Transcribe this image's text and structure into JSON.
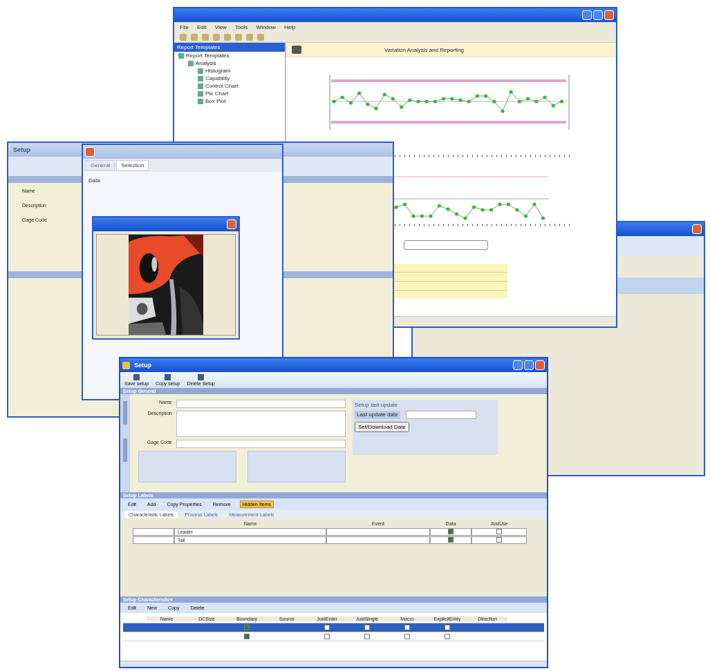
{
  "chart_window": {
    "menu": [
      "File",
      "Edit",
      "View",
      "Tools",
      "Window",
      "Help"
    ],
    "tree_title": "Report Templates",
    "tree": [
      {
        "label": "Report Templates",
        "children": [
          {
            "label": "Analysis",
            "children": [
              {
                "label": "Histogram"
              },
              {
                "label": "Capability"
              },
              {
                "label": "Control Chart"
              },
              {
                "label": "Pie Chart"
              },
              {
                "label": "Box Plot"
              }
            ]
          }
        ]
      }
    ],
    "header": "Variation Analysis and Reporting"
  },
  "back_setup": {
    "title": "Setup",
    "labels": [
      "Name",
      "Description",
      "Gage Code"
    ]
  },
  "editor_window": {
    "tabs": [
      {
        "label": "General",
        "selected": false
      },
      {
        "label": "Selection",
        "selected": true
      }
    ],
    "field_label": "Data"
  },
  "setup_window": {
    "title": "Setup",
    "toolbar": [
      "Save setup",
      "Copy setup",
      "Delete Setup"
    ],
    "general": {
      "title": "Setup General",
      "fields": [
        "Name",
        "Description",
        "Gage Code"
      ],
      "update_group": "Setup last update",
      "update_label": "Last update date",
      "update_button": "Set/Download Date"
    },
    "labels": {
      "title": "Setup Labels",
      "toolbar": [
        {
          "label": "Edit",
          "on": false
        },
        {
          "label": "Add",
          "on": false
        },
        {
          "label": "Copy Properties",
          "on": false
        },
        {
          "label": "Remove",
          "on": false
        },
        {
          "label": "Hidden Items",
          "on": true
        }
      ],
      "tabs": [
        {
          "label": "Characteristic Labels",
          "selected": true
        },
        {
          "label": "Process Labels",
          "selected": false
        },
        {
          "label": "Measurement Labels",
          "selected": false
        }
      ],
      "columns": [
        "Name",
        "Event",
        "Data",
        "JustUse"
      ],
      "rows": [
        {
          "name": "Leader",
          "data": true,
          "justuse": false
        },
        {
          "name": "Tail",
          "data": true,
          "justuse": false
        }
      ]
    },
    "characteristics": {
      "title": "Setup Characteristics",
      "toolbar": [
        "Edit",
        "New",
        "Copy",
        "Delete"
      ],
      "columns": [
        "Name",
        "DCSize",
        "Boundary",
        "Source",
        "JustEnter",
        "JustSingle",
        "Macro",
        "ExplicitEntry",
        "Direction"
      ],
      "rows": [
        {
          "selected": true,
          "boundary": true,
          "justenter": false,
          "justsingle": false,
          "macro": false,
          "explicit": false
        },
        {
          "selected": false,
          "boundary": true,
          "justenter": false,
          "justsingle": false,
          "macro": false,
          "explicit": false
        }
      ]
    }
  }
}
